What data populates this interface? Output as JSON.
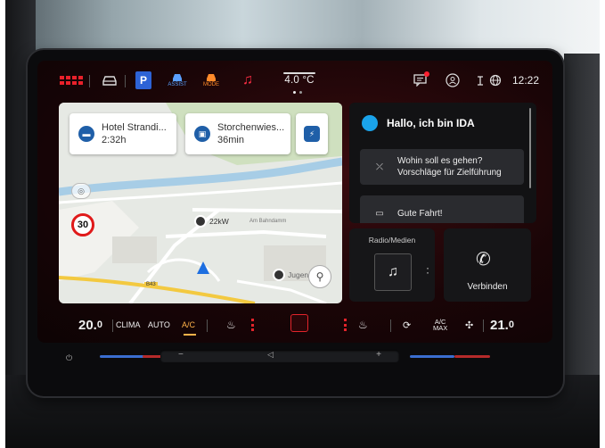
{
  "status_bar": {
    "outside_temp": "4.0 °C",
    "clock": "12:22",
    "parking_label": "P",
    "assist_label": "ASSIST",
    "mode_label": "MODE"
  },
  "map": {
    "destinations": [
      {
        "name": "Hotel Strandi...",
        "duration": "2:32h"
      },
      {
        "name": "Storchenwies...",
        "duration": "36min"
      }
    ],
    "speed_limit": "30",
    "charger_label": "22kW",
    "street_label": "Am Bahndamm",
    "poi_label": "Jugen",
    "road_badge": "B43"
  },
  "ida": {
    "greeting": "Hallo, ich bin IDA",
    "suggestions": [
      {
        "title": "Wohin soll es gehen?",
        "subtitle": "Vorschläge für Zielführung"
      },
      {
        "title": "Gute Fahrt!",
        "subtitle": ""
      }
    ]
  },
  "tiles": {
    "radio_label": "Radio/Medien",
    "phone_label": "Verbinden"
  },
  "climate": {
    "temp_left": "20.",
    "temp_left_decimal": "0",
    "clima_label": "CLIMA",
    "auto_label": "AUTO",
    "ac_label": "A/C",
    "acmax_top": "A/C",
    "acmax_bottom": "MAX",
    "temp_right": "21.",
    "temp_right_decimal": "0"
  },
  "colors": {
    "accent_red": "#e2242b",
    "ida_blue": "#1aa3ea",
    "map_pin_blue": "#1e6fe0"
  }
}
